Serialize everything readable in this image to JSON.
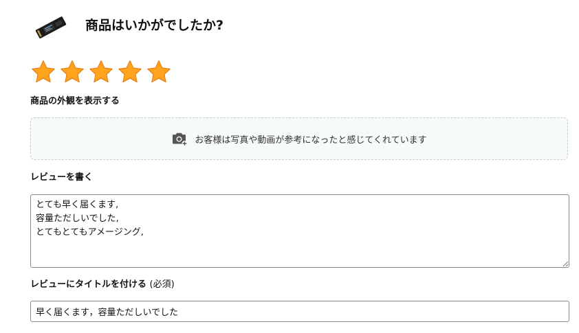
{
  "header": {
    "title": "商品はいかがでしたか?",
    "product_image_icon": "ssd-product-thumbnail"
  },
  "rating": {
    "value": 5,
    "max": 5,
    "star_color": "#FFA41C",
    "star_outline": "#E47911"
  },
  "appearance": {
    "label": "商品の外観を表示する",
    "upload_icon": "camera-add-icon",
    "upload_text": "お客様は写真や動画が参考になったと感じてくれています"
  },
  "review": {
    "label": "レビューを書く",
    "text": "とても早く届くます,\n容量ただしいでした,\nとてもとてもアメージング,"
  },
  "review_title": {
    "label": "レビューにタイトルを付ける",
    "required_note": "(必須)",
    "value": "早く届くます，容量ただしいでした"
  }
}
